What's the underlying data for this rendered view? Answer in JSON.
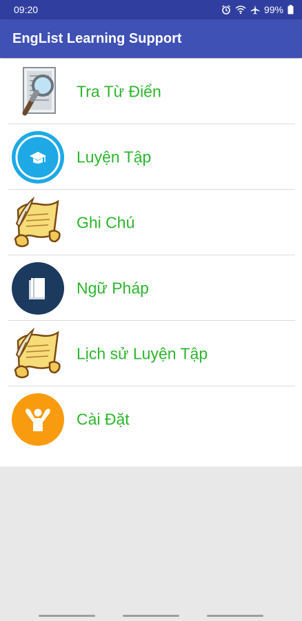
{
  "status_bar": {
    "time": "09:20",
    "battery": "99%",
    "icons": [
      "alarm-icon",
      "wifi-icon",
      "airplane-icon",
      "battery-icon"
    ]
  },
  "app_bar": {
    "title": "EngList Learning Support"
  },
  "menu": {
    "items": [
      {
        "label": "Tra Từ Điển",
        "icon": "dictionary-search-icon"
      },
      {
        "label": "Luyện Tập",
        "icon": "graduation-cap-icon"
      },
      {
        "label": "Ghi Chú",
        "icon": "scroll-quill-icon"
      },
      {
        "label": "Ngữ Pháp",
        "icon": "book-icon"
      },
      {
        "label": "Lịch sử Luyện Tập",
        "icon": "scroll-quill-icon"
      },
      {
        "label": "Cài Đặt",
        "icon": "person-settings-icon"
      }
    ]
  },
  "colors": {
    "status_bar": "#303f9f",
    "app_bar": "#3f51b5",
    "label_green": "#2db52d",
    "cyan_accent": "#1ea9e6",
    "navy_accent": "#1c3a5e",
    "orange_accent": "#f99b0e"
  }
}
